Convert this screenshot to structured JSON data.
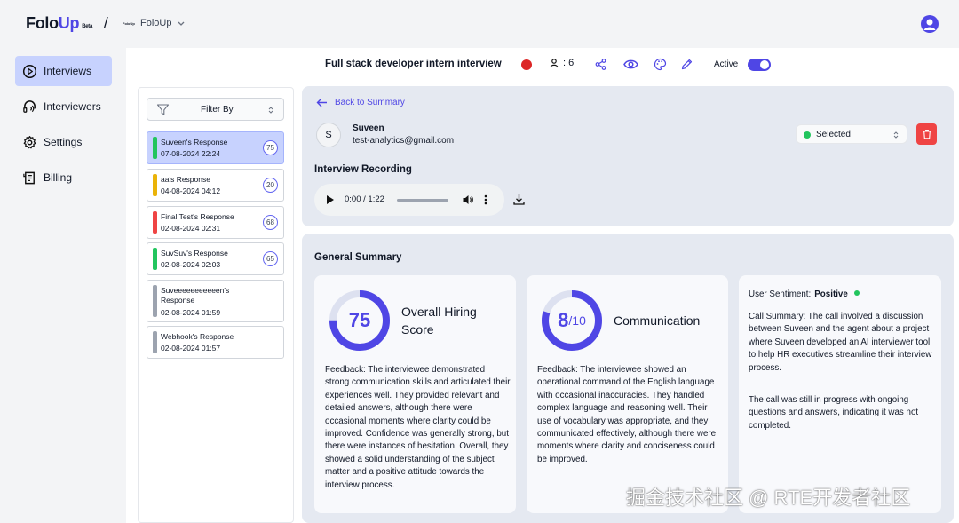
{
  "brand": {
    "name_part1": "Folo",
    "name_part2": "Up",
    "beta": "Beta"
  },
  "breadcrumb": {
    "separator": "/",
    "org_logo_text": "FoloUp",
    "org_name": "FoloUp"
  },
  "sidebar": {
    "items": [
      {
        "label": "Interviews",
        "icon": "play-circle-icon",
        "active": true
      },
      {
        "label": "Interviewers",
        "icon": "headset-icon",
        "active": false
      },
      {
        "label": "Settings",
        "icon": "gear-icon",
        "active": false
      },
      {
        "label": "Billing",
        "icon": "receipt-icon",
        "active": false
      }
    ]
  },
  "header": {
    "title": "Full stack developer intern interview",
    "responses_count": ": 6",
    "active_label": "Active",
    "active": true
  },
  "filter": {
    "label": "Filter By"
  },
  "responses": [
    {
      "name": "Suveen's Response",
      "date": "07-08-2024 22:24",
      "score": "75",
      "color": "#22c55e",
      "selected": true
    },
    {
      "name": "aa's Response",
      "date": "04-08-2024 04:12",
      "score": "20",
      "color": "#eab308",
      "selected": false
    },
    {
      "name": "Final Test's Response",
      "date": "02-08-2024 02:31",
      "score": "68",
      "color": "#ef4444",
      "selected": false
    },
    {
      "name": "SuvSuv's Response",
      "date": "02-08-2024 02:03",
      "score": "65",
      "color": "#22c55e",
      "selected": false
    },
    {
      "name": "Suveeeeeeeeeeen's Response",
      "date": "02-08-2024 01:59",
      "score": "",
      "color": "#9ca3af",
      "selected": false
    },
    {
      "name": "Webhook's Response",
      "date": "02-08-2024 01:57",
      "score": "",
      "color": "#9ca3af",
      "selected": false
    }
  ],
  "detail": {
    "back_label": "Back to Summary",
    "candidate_initial": "S",
    "candidate_name": "Suveen",
    "candidate_email": "test-analytics@gmail.com",
    "status": "Selected",
    "status_color": "#22c55e",
    "recording_title": "Interview Recording",
    "player_time": "0:00 / 1:22"
  },
  "summary": {
    "title": "General Summary",
    "hiring": {
      "score": "75",
      "score_value": 75,
      "title": "Overall Hiring Score",
      "feedback": "Feedback: The interviewee demonstrated strong communication skills and articulated their experiences well. They provided relevant and detailed answers, although there were occasional moments where clarity could be improved. Confidence was generally strong, but there were instances of hesitation. Overall, they showed a solid understanding of the subject matter and a positive attitude towards the interview process."
    },
    "communication": {
      "score": "8",
      "out_of": "/10",
      "score_value": 0.8,
      "title": "Communication",
      "feedback": "Feedback: The interviewee showed an operational command of the English language with occasional inaccuracies. They handled complex language and reasoning well. Their use of vocabulary was appropriate, and they communicated effectively, although there were moments where clarity and conciseness could be improved."
    },
    "sentiment": {
      "label": "User Sentiment:",
      "value": "Positive",
      "call_summary": "Call Summary: The call involved a discussion between Suveen and the agent about a project where Suveen developed an AI interviewer tool to help HR executives streamline their interview process.",
      "call_status": "The call was still in progress with ongoing questions and answers, indicating it was not completed."
    }
  },
  "colors": {
    "accent": "#4f46e5",
    "accent_light": "#c7d2fe",
    "danger": "#ef4444",
    "success": "#22c55e"
  },
  "watermark": "掘金技术社区 @ RTE开发者社区"
}
